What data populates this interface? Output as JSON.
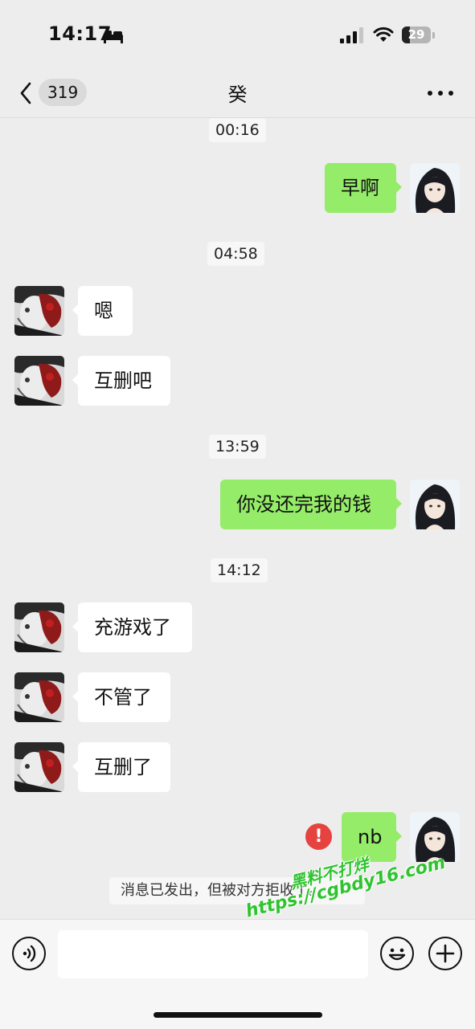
{
  "status_bar": {
    "time": "14:17",
    "battery_level": "29",
    "battery_fraction": 0.29
  },
  "nav": {
    "unread_count": "319",
    "title": "癸"
  },
  "messages": [
    {
      "type": "timestamp",
      "text": "00:16"
    },
    {
      "type": "outgoing",
      "text": "早啊"
    },
    {
      "type": "timestamp",
      "text": "04:58"
    },
    {
      "type": "incoming",
      "text": "嗯"
    },
    {
      "type": "incoming",
      "text": "互删吧"
    },
    {
      "type": "timestamp",
      "text": "13:59"
    },
    {
      "type": "outgoing",
      "text": "你没还完我的钱"
    },
    {
      "type": "timestamp",
      "text": "14:12"
    },
    {
      "type": "incoming",
      "text": "充游戏了"
    },
    {
      "type": "incoming",
      "text": "不管了"
    },
    {
      "type": "incoming",
      "text": "互删了"
    },
    {
      "type": "outgoing_failed",
      "text": "nb"
    },
    {
      "type": "system",
      "text": "消息已发出，但被对方拒收了。"
    }
  ],
  "watermark": {
    "line1": "黑料不打烊",
    "line2": "https://cgbdy16.com"
  },
  "input_bar": {
    "placeholder": ""
  },
  "icons": {
    "voice": "voice-icon",
    "emoji": "emoji-icon",
    "plus": "plus-icon",
    "error": "error-icon",
    "back": "chevron-left-icon",
    "more": "more-icon"
  },
  "colors": {
    "background": "#ededed",
    "outgoing_bubble": "#95ec69",
    "incoming_bubble": "#ffffff",
    "error": "#e64340"
  }
}
